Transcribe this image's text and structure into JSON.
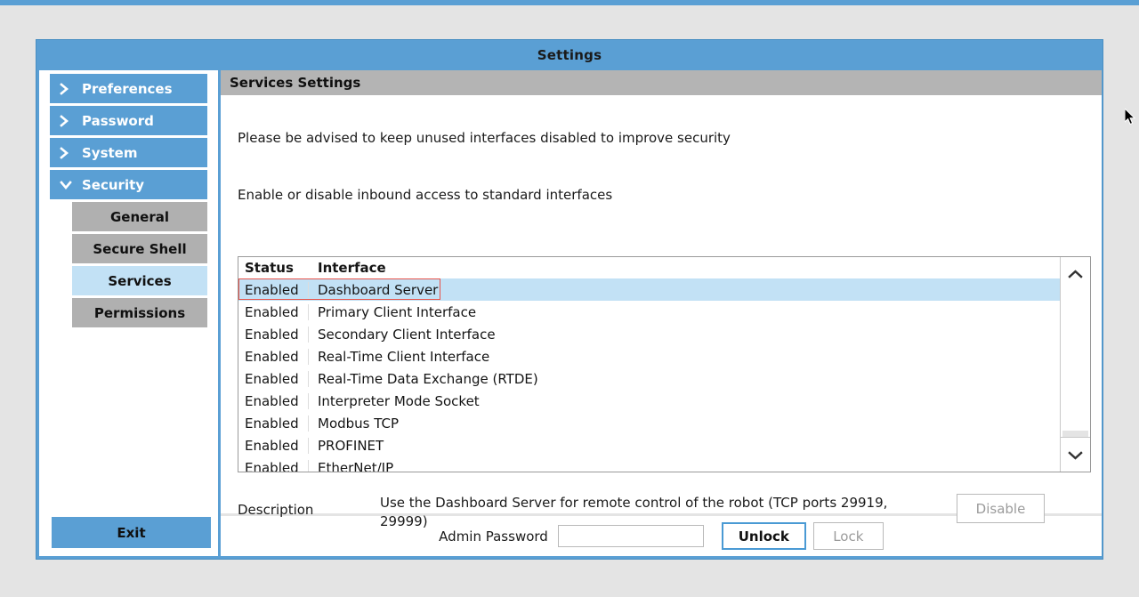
{
  "window": {
    "title": "Settings"
  },
  "sidebar": {
    "items": [
      {
        "label": "Preferences",
        "icon": "chevron-right-icon",
        "expanded": false
      },
      {
        "label": "Password",
        "icon": "chevron-right-icon",
        "expanded": false
      },
      {
        "label": "System",
        "icon": "chevron-right-icon",
        "expanded": false
      },
      {
        "label": "Security",
        "icon": "chevron-down-icon",
        "expanded": true
      }
    ],
    "sub_items": [
      {
        "label": "General",
        "active": false
      },
      {
        "label": "Secure Shell",
        "active": false
      },
      {
        "label": "Services",
        "active": true
      },
      {
        "label": "Permissions",
        "active": false
      }
    ],
    "exit_label": "Exit"
  },
  "panel": {
    "header": "Services Settings",
    "info_1": "Please be advised to keep unused interfaces disabled to improve security",
    "info_2": "Enable or disable inbound access to standard interfaces"
  },
  "table": {
    "columns": [
      "Status",
      "Interface"
    ],
    "rows": [
      {
        "status": "Enabled",
        "interface": "Dashboard Server",
        "selected": true
      },
      {
        "status": "Enabled",
        "interface": "Primary Client Interface",
        "selected": false
      },
      {
        "status": "Enabled",
        "interface": "Secondary Client Interface",
        "selected": false
      },
      {
        "status": "Enabled",
        "interface": "Real-Time Client Interface",
        "selected": false
      },
      {
        "status": "Enabled",
        "interface": "Real-Time Data Exchange (RTDE)",
        "selected": false
      },
      {
        "status": "Enabled",
        "interface": "Interpreter Mode Socket",
        "selected": false
      },
      {
        "status": "Enabled",
        "interface": "Modbus TCP",
        "selected": false
      },
      {
        "status": "Enabled",
        "interface": "PROFINET",
        "selected": false
      },
      {
        "status": "Enabled",
        "interface": "EtherNet/IP",
        "selected": false
      }
    ],
    "scroll_up_icon": "chevron-up-icon",
    "scroll_down_icon": "chevron-down-icon"
  },
  "description": {
    "label": "Description",
    "text": "Use the Dashboard Server for remote control of the robot (TCP ports 29919, 29999)",
    "toggle_label": "Disable"
  },
  "bottom": {
    "password_label": "Admin Password",
    "password_value": "",
    "password_placeholder": "",
    "unlock_label": "Unlock",
    "lock_label": "Lock"
  },
  "colors": {
    "accent_blue": "#5a9fd4",
    "selection_blue": "#c2e1f5",
    "highlight_red": "#e8534a",
    "panel_gray": "#b4b4b4",
    "sub_item_gray": "#b0b0b0"
  }
}
